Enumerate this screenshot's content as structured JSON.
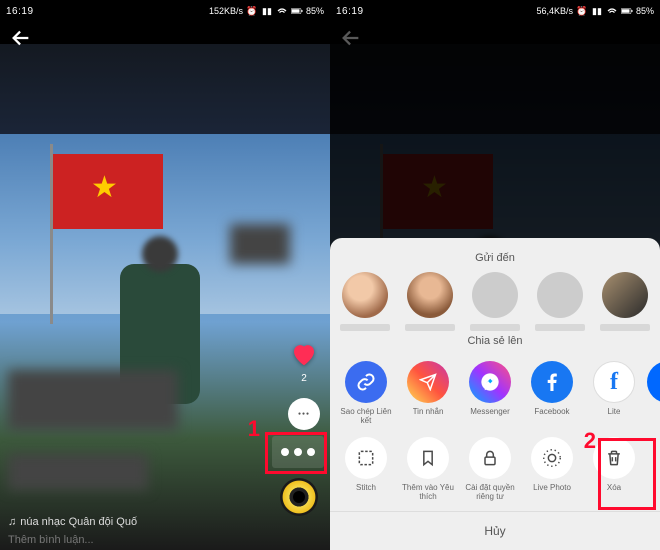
{
  "status": {
    "time": "16:19",
    "speed1": "152KB/s",
    "speed2": "56,4KB/s",
    "battery": "85%"
  },
  "video": {
    "like_count": "2",
    "music": "núa nhạc Quân đội   Quố",
    "comment_placeholder": "Thêm bình luận..."
  },
  "annot": {
    "num1": "1",
    "num2": "2"
  },
  "sheet": {
    "send_to": "Gửi đến",
    "share_to": "Chia sẻ lên",
    "cancel": "Hủy",
    "share": {
      "copy_link": "Sao chép Liên kết",
      "messages": "Tin nhắn",
      "messenger": "Messenger",
      "facebook": "Facebook",
      "lite": "Lite"
    },
    "actions": {
      "stitch": "Stitch",
      "favorite": "Thêm vào Yêu thích",
      "privacy": "Cài đặt quyền riêng tư",
      "live_photo": "Live Photo",
      "delete": "Xóa"
    }
  }
}
